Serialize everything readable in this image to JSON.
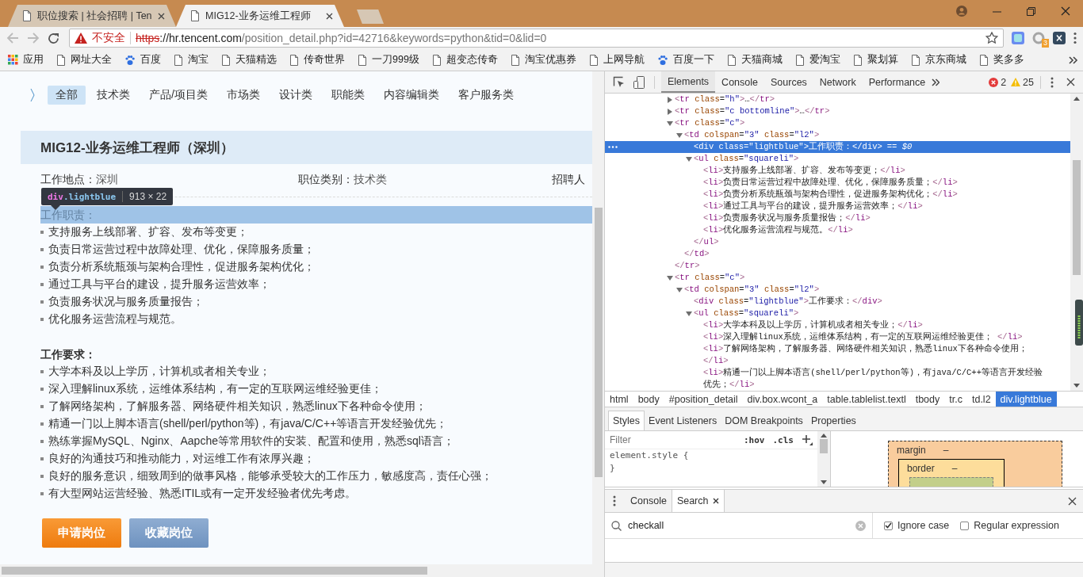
{
  "browser": {
    "tabs": [
      {
        "title": "职位搜索 | 社会招聘 | Ten",
        "selected": false
      },
      {
        "title": "MIG12-业务运维工程师",
        "selected": true
      }
    ],
    "security_label": "不安全",
    "url": {
      "scheme": "https",
      "host": "://hr.tencent.com",
      "path": "/position_detail.php?id=42716&keywords=python&tid=0&lid=0"
    },
    "extension_badge": "3",
    "bookmarks": [
      {
        "label": "应用",
        "kind": "apps"
      },
      {
        "label": "网址大全",
        "kind": "page"
      },
      {
        "label": "百度",
        "kind": "paw"
      },
      {
        "label": "淘宝",
        "kind": "page"
      },
      {
        "label": "天猫精选",
        "kind": "page"
      },
      {
        "label": "传奇世界",
        "kind": "page"
      },
      {
        "label": "一刀999级",
        "kind": "page"
      },
      {
        "label": "超变态传奇",
        "kind": "page"
      },
      {
        "label": "淘宝优惠券",
        "kind": "page"
      },
      {
        "label": "上网导航",
        "kind": "page"
      },
      {
        "label": "百度一下",
        "kind": "paw"
      },
      {
        "label": "天猫商城",
        "kind": "page"
      },
      {
        "label": "爱淘宝",
        "kind": "page"
      },
      {
        "label": "聚划算",
        "kind": "page"
      },
      {
        "label": "京东商城",
        "kind": "page"
      },
      {
        "label": "奖多多",
        "kind": "page"
      }
    ]
  },
  "page": {
    "categories": [
      {
        "label": "全部",
        "selected": true
      },
      {
        "label": "技术类",
        "selected": false
      },
      {
        "label": "产品/项目类",
        "selected": false
      },
      {
        "label": "市场类",
        "selected": false
      },
      {
        "label": "设计类",
        "selected": false
      },
      {
        "label": "职能类",
        "selected": false
      },
      {
        "label": "内容编辑类",
        "selected": false
      },
      {
        "label": "客户服务类",
        "selected": false
      }
    ],
    "job_title": "MIG12-业务运维工程师（深圳）",
    "info": [
      {
        "label": "工作地点：",
        "value": "深圳"
      },
      {
        "label": "职位类别：",
        "value": "技术类"
      },
      {
        "label": "招聘人"
      }
    ],
    "inspect_tooltip": {
      "tag": "div",
      "class": ".lightblue",
      "size": "913 × 22"
    },
    "sections": [
      {
        "title": "工作职责：",
        "highlighted": true,
        "items": [
          "支持服务上线部署、扩容、发布等变更；",
          "负责日常运营过程中故障处理、优化，保障服务质量；",
          "负责分析系统瓶颈与架构合理性，促进服务架构优化；",
          "通过工具与平台的建设，提升服务运营效率；",
          "负责服务状况与服务质量报告；",
          "优化服务运营流程与规范。"
        ]
      },
      {
        "title": "工作要求：",
        "highlighted": false,
        "items": [
          "大学本科及以上学历，计算机或者相关专业；",
          "深入理解linux系统，运维体系结构，有一定的互联网运维经验更佳；",
          "了解网络架构，了解服务器、网络硬件相关知识，熟悉linux下各种命令使用；",
          "精通一门以上脚本语言(shell/perl/python等)，有java/C/C++等语言开发经验优先；",
          "熟练掌握MySQL、Nginx、Aapche等常用软件的安装、配置和使用，熟悉sql语言；",
          "良好的沟通技巧和推动能力，对运维工作有浓厚兴趣；",
          "良好的服务意识，细致周到的做事风格，能够承受较大的工作压力，敏感度高，责任心强；",
          "有大型网站运营经验、熟悉ITIL或有一定开发经验者优先考虑。"
        ]
      }
    ],
    "buttons": [
      {
        "label": "申请岗位",
        "kind": "primary"
      },
      {
        "label": "收藏岗位",
        "kind": "secondary"
      }
    ]
  },
  "devtools": {
    "panels": [
      {
        "label": "Elements",
        "selected": true
      },
      {
        "label": "Console",
        "selected": false
      },
      {
        "label": "Sources",
        "selected": false
      },
      {
        "label": "Network",
        "selected": false
      },
      {
        "label": "Performance",
        "selected": false
      }
    ],
    "errors": "2",
    "warnings": "25",
    "tree": [
      {
        "lines": [
          "<tr class=\"h\">…</tr>"
        ],
        "expanded": false,
        "selected": false
      },
      {
        "lines": [
          "<tr class=\"c bottomline\">…</tr>"
        ],
        "expanded": false,
        "selected": false
      },
      {
        "lines": [
          "<tr class=\"c\">"
        ],
        "expanded": true,
        "selected": false,
        "close": "</tr>",
        "children": [
          {
            "lines": [
              "<td colspan=\"3\" class=\"l2\">"
            ],
            "expanded": true,
            "selected": false,
            "close": "</td>",
            "children": [
              {
                "lines": [
                  "<div class=\"lightblue\">工作职责：</div>"
                ],
                "selected": true,
                "suffix": "== $0"
              },
              {
                "lines": [
                  "<ul class=\"squareli\">"
                ],
                "expanded": true,
                "selected": false,
                "close": "</ul>",
                "children": [
                  {
                    "lines": [
                      "<li>支持服务上线部署、扩容、发布等变更；</li>"
                    ],
                    "selected": false
                  },
                  {
                    "lines": [
                      "<li>负责日常运营过程中故障处理、优化，保障服务质量；</li>"
                    ],
                    "selected": false
                  },
                  {
                    "lines": [
                      "<li>负责分析系统瓶颈与架构合理性，促进服务架构优化；</li>"
                    ],
                    "selected": false
                  },
                  {
                    "lines": [
                      "<li>通过工具与平台的建设，提升服务运营效率；</li>"
                    ],
                    "selected": false
                  },
                  {
                    "lines": [
                      "<li>负责服务状况与服务质量报告；</li>"
                    ],
                    "selected": false
                  },
                  {
                    "lines": [
                      "<li>优化服务运营流程与规范。</li>"
                    ],
                    "selected": false
                  }
                ]
              }
            ]
          }
        ]
      },
      {
        "lines": [
          "<tr class=\"c\">"
        ],
        "expanded": true,
        "selected": false,
        "children": [
          {
            "lines": [
              "<td colspan=\"3\" class=\"l2\">"
            ],
            "expanded": true,
            "selected": false,
            "children": [
              {
                "lines": [
                  "<div class=\"lightblue\">工作要求：</div>"
                ],
                "selected": false
              },
              {
                "lines": [
                  "<ul class=\"squareli\">"
                ],
                "expanded": true,
                "selected": false,
                "children": [
                  {
                    "lines": [
                      "<li>大学本科及以上学历，计算机或者相关专业；</li>"
                    ],
                    "selected": false
                  },
                  {
                    "lines": [
                      "<li>深入理解linux系统，运维体系结构，有一定的互联网运维经验更佳；  </li>"
                    ],
                    "selected": false
                  },
                  {
                    "lines": [
                      "<li>了解网络架构，了解服务器、网络硬件相关知识，熟悉linux下各种命令使用；",
                      "</li>"
                    ],
                    "selected": false
                  },
                  {
                    "lines": [
                      "<li>精通一门以上脚本语言(shell/perl/python等)，有java/C/C++等语言开发经验",
                      "优先；</li>"
                    ],
                    "selected": false
                  }
                ]
              }
            ]
          }
        ]
      }
    ],
    "breadcrumbs": [
      {
        "label": "html",
        "selected": false
      },
      {
        "label": "body",
        "selected": false
      },
      {
        "label": "#position_detail",
        "selected": false
      },
      {
        "label": "div.box.wcont_a",
        "selected": false
      },
      {
        "label": "table.tablelist.textl",
        "selected": false
      },
      {
        "label": "tbody",
        "selected": false
      },
      {
        "label": "tr.c",
        "selected": false
      },
      {
        "label": "td.l2",
        "selected": false
      },
      {
        "label": "div.lightblue",
        "selected": true
      }
    ],
    "sidebar_tabs": [
      {
        "label": "Styles",
        "selected": true
      },
      {
        "label": "Event Listeners",
        "selected": false
      },
      {
        "label": "DOM Breakpoints",
        "selected": false
      },
      {
        "label": "Properties",
        "selected": false
      }
    ],
    "styles": {
      "filter_placeholder": "Filter",
      "hov": ":hov",
      "cls": ".cls",
      "rules": [
        "element.style {",
        "}"
      ]
    },
    "box_model": {
      "margin": "margin",
      "margin_value": "–",
      "border": "border",
      "border_value": "–"
    },
    "drawer_tabs": [
      {
        "label": "Console",
        "selected": false,
        "closable": false
      },
      {
        "label": "Search",
        "selected": true,
        "closable": true
      }
    ],
    "search": {
      "value": "checkall",
      "options": [
        {
          "label": "Ignore case",
          "checked": true
        },
        {
          "label": "Regular expression",
          "checked": false
        }
      ]
    }
  }
}
